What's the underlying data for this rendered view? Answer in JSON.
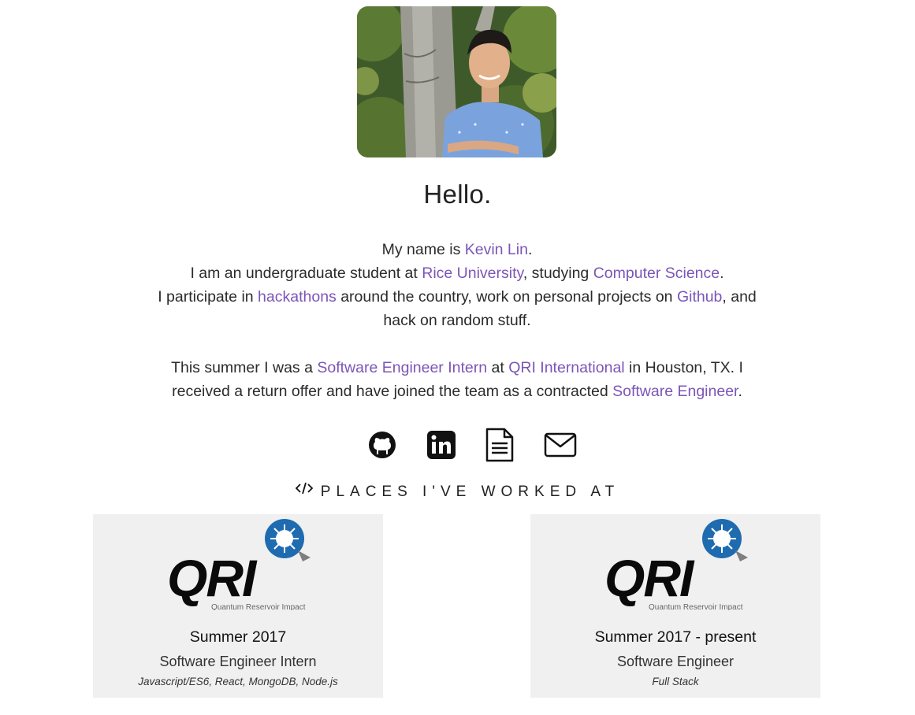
{
  "profile": {
    "photo_alt": "Kevin Lin",
    "greeting": "Hello."
  },
  "bio": {
    "line1_pre": "My name is ",
    "name": "Kevin Lin",
    "line1_post": ".",
    "line2_pre": "I am an undergraduate student at ",
    "university": "Rice University",
    "line2_mid": ", studying ",
    "major": "Computer Science",
    "line2_post": ".",
    "line3_pre": "I participate in ",
    "hackathons": "hackathons",
    "line3_mid": " around the country, work on personal projects on ",
    "github": "Github",
    "line3_post": ", and",
    "line4": "hack on random stuff.",
    "p2_pre": "This summer I was a ",
    "intern_role": "Software Engineer Intern",
    "p2_at": " at ",
    "company": "QRI International",
    "p2_mid": " in Houston, TX. I",
    "p2_line2_pre": "received a return offer and have joined the team as a contracted ",
    "engineer_role": "Software Engineer",
    "p2_post": "."
  },
  "social": [
    {
      "name": "github-icon"
    },
    {
      "name": "linkedin-icon"
    },
    {
      "name": "resume-document-icon"
    },
    {
      "name": "email-icon"
    }
  ],
  "places": {
    "heading": "PLACES I'VE WORKED AT",
    "icon": "code-icon"
  },
  "jobs": [
    {
      "logo_text": "QRI",
      "logo_sub": "Quantum Reservoir Impact",
      "period": "Summer 2017",
      "role": "Software Engineer Intern",
      "stack": "Javascript/ES6, React, MongoDB, Node.js"
    },
    {
      "logo_text": "QRI",
      "logo_sub": "Quantum Reservoir Impact",
      "period": "Summer 2017 - present",
      "role": "Software Engineer",
      "stack": "Full Stack"
    }
  ],
  "colors": {
    "link": "#7b55b8",
    "card_bg": "#f0f0f0",
    "qri_blue": "#1e6bb0"
  }
}
